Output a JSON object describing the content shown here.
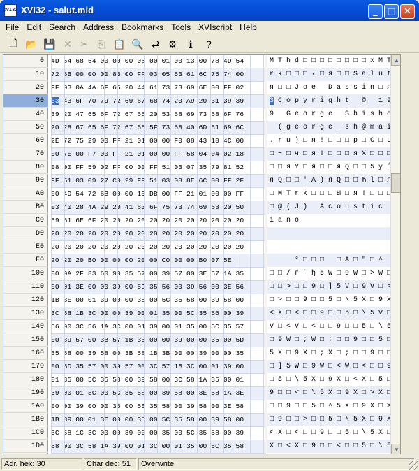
{
  "window": {
    "title": "XVI32 - salut.mid",
    "icon_text": "XVI32",
    "controls": {
      "minimize": "_",
      "maximize": "□",
      "close": "✕"
    }
  },
  "menu": [
    "File",
    "Edit",
    "Search",
    "Address",
    "Bookmarks",
    "Tools",
    "XVIscript",
    "Help"
  ],
  "toolbar": [
    {
      "name": "new-icon",
      "glyph": "🗋",
      "enabled": true
    },
    {
      "name": "open-icon",
      "glyph": "📂",
      "enabled": true
    },
    {
      "name": "save-icon",
      "glyph": "💾",
      "enabled": true
    },
    {
      "name": "delete-icon",
      "glyph": "✕",
      "enabled": false
    },
    {
      "name": "cut-icon",
      "glyph": "✂",
      "enabled": false
    },
    {
      "name": "copy-icon",
      "glyph": "⎘",
      "enabled": false
    },
    {
      "name": "paste-icon",
      "glyph": "📋",
      "enabled": true
    },
    {
      "name": "find-icon",
      "glyph": "🔍",
      "enabled": true
    },
    {
      "name": "replace-icon",
      "glyph": "⇄",
      "enabled": true
    },
    {
      "name": "properties-icon",
      "glyph": "⚙",
      "enabled": true
    },
    {
      "name": "info-icon",
      "glyph": "ℹ",
      "enabled": true
    },
    {
      "name": "context-help-icon",
      "glyph": "?",
      "enabled": true
    }
  ],
  "hex_rows": [
    {
      "addr": "0",
      "hex": "4D 54 68 64 00 00 00 06 00 01 00 13 00 78 4D 54",
      "chars": "M T h d □ □ □ □ □ □ □ □ x M T"
    },
    {
      "addr": "10",
      "hex": "72 6B 00 00 00 8B 00 FF 03 05 53 61 6C 75 74 00",
      "chars": "r k □ □ □ ‹ □ я □ □ S a l u t □"
    },
    {
      "addr": "20",
      "hex": "FF 03 0A 4A 6F 65 20 44 61 73 73 69 6E 00 FF 02",
      "chars": "я □ □ J o e   D a s s i n □ я □"
    },
    {
      "addr": "30",
      "hex": "33 43 6F 70 79 72 69 67 68 74 20 A9 20 31 39 39",
      "chars": "3 C o p y r i g h t   ©   1 9 9",
      "sel": true
    },
    {
      "addr": "40",
      "hex": "39 20 47 65 6F 72 67 65 20 53 68 69 73 68 6F 76",
      "chars": "9   G e o r g e   S h i s h o v"
    },
    {
      "addr": "50",
      "hex": "20 28 67 65 6F 72 67 65 5F 73 68 40 6D 61 69 6C",
      "chars": "  ( g e o r g e _ s h @ m a i l"
    },
    {
      "addr": "60",
      "hex": "2E 72 75 29 00 FF 21 01 00 00 F0 08 43 10 4C 00",
      "chars": ". r u ) □ я ! □ □ □ р □ C □ L □"
    },
    {
      "addr": "70",
      "hex": "00 7E 00 F7 00 FF 21 01 00 00 FF 58 04 04 02 18",
      "chars": "□ ~ □ ч □ я ! □ □ □ я X □ □ □ □"
    },
    {
      "addr": "80",
      "hex": "08 00 FF 59 02 FF 00 00 FF 51 03 07 35 79 81 52",
      "chars": "□ □ я Y □ я □ □ я Q □ □ 5 y Ѓ R"
    },
    {
      "addr": "90",
      "hex": "FF 51 03 09 27 C0 29 FF 51 03 08 8E 6C 00 FF 2F",
      "chars": "я Q □ □ ' А ) я Q □ □ Ћ l □ я /"
    },
    {
      "addr": "A0",
      "hex": "00 4D 54 72 6B 00 00 1E DB 00 FF 21 01 00 00 FF",
      "chars": "□ M T r k □ □ □ Ы □ я ! □ □ □ я"
    },
    {
      "addr": "B0",
      "hex": "03 40 28 4A 29 20 41 63 6F 75 73 74 69 63 20 50",
      "chars": "□ @ ( J )   A c o u s t i c   P"
    },
    {
      "addr": "C0",
      "hex": "69 61 6E 6F 20 20 20 20 20 20 20 20 20 20 20 20",
      "chars": "i a n o"
    },
    {
      "addr": "D0",
      "hex": "20 20 20 20 20 20 20 20 20 20 20 20 20 20 20 20",
      "chars": ""
    },
    {
      "addr": "E0",
      "hex": "20 20 20 20 20 20 20 20 20 20 20 20 20 20 20 20",
      "chars": ""
    },
    {
      "addr": "F0",
      "hex": "20 20 20 B0 00 00 00 20 00 C0 00 00 B0 07 5E",
      "chars": "      ° □ □ □   □ А □ \" □ ^"
    },
    {
      "addr": "100",
      "hex": "00 0A 2F 83 60 90 35 57 00 39 57 00 3E 57 1A 35",
      "chars": "□ □ / ѓ ` ђ 5 W □ 9 W □ > W □ 5"
    },
    {
      "addr": "110",
      "hex": "00 01 3E 00 00 39 00 5D 35 56 00 39 56 00 3E 56",
      "chars": "□ □ > □ □ 9 □ ] 5 V □ 9 V □ > V"
    },
    {
      "addr": "120",
      "hex": "1B 3E 00 01 39 00 00 35 00 5C 35 58 00 39 58 00",
      "chars": "□ > □ □ 9 □ □ 5 □ \\ 5 X □ 9 X □"
    },
    {
      "addr": "130",
      "hex": "3C 58 1B 3C 00 00 39 00 01 35 00 5C 35 56 00 39",
      "chars": "< X □ < □ □ 9 □ □ 5 □ \\ 5 V □ 9"
    },
    {
      "addr": "140",
      "hex": "56 00 3C 56 1A 3C 00 01 39 00 01 35 00 5C 35 57",
      "chars": "V □ < V □ < □ □ 9 □ □ 5 □ \\ 5 W"
    },
    {
      "addr": "150",
      "hex": "00 39 57 00 3B 57 1B 3B 00 00 39 00 00 35 00 5D",
      "chars": "□ 9 W □ ; W □ ; □ □ 9 □ □ 5 □ ]"
    },
    {
      "addr": "160",
      "hex": "35 58 00 39 58 00 3B 58 1B 3B 00 00 39 00 00 35",
      "chars": "5 X □ 9 X □ ; X □ ; □ □ 9 □ □ 5"
    },
    {
      "addr": "170",
      "hex": "00 5D 35 57 00 39 57 00 3C 57 1B 3C 00 01 39 00",
      "chars": "□ ] 5 W □ 9 W □ < W □ < □ □ 9 □"
    },
    {
      "addr": "180",
      "hex": "01 35 00 5C 35 58 00 39 58 00 3C 58 1A 35 00 01",
      "chars": "□ 5 □ \\ 5 X □ 9 X □ < X □ 5 □ □"
    },
    {
      "addr": "190",
      "hex": "39 00 01 3C 00 5C 35 58 00 39 58 00 3E 58 1A 3E",
      "chars": "9 □ □ < □ \\ 5 X □ 9 X □ > X □ >"
    },
    {
      "addr": "1A0",
      "hex": "00 00 39 00 00 35 00 5E 35 58 00 39 58 00 3E 58",
      "chars": "□ □ 9 □ □ 5 □ ^ 5 X □ 9 X □ > X"
    },
    {
      "addr": "1B0",
      "hex": "1B 39 00 01 3E 00 00 35 00 5C 35 58 00 39 58 00",
      "chars": "□ 9 □ □ > □ □ 5 □ \\ 5 X □ 9 X □"
    },
    {
      "addr": "1C0",
      "hex": "3C 58 1C 3C 00 00 39 00 00 35 00 5C 35 58 00 39",
      "chars": "< X □ < □ □ 9 □ □ 5 □ \\ 5 X □ 9"
    },
    {
      "addr": "1D0",
      "hex": "58 00 3C 58 1A 39 00 01 3C 00 01 35 00 5C 35 58",
      "chars": "X □ < X □ 9 □ □ < □ □ 5 □ \\ 5 X"
    }
  ],
  "status": {
    "addr_hex": "Adr. hex: 30",
    "char_dec": "Char dec: 51",
    "mode": "Overwrite"
  },
  "scroll": {
    "up": "▲",
    "down": "▼"
  }
}
